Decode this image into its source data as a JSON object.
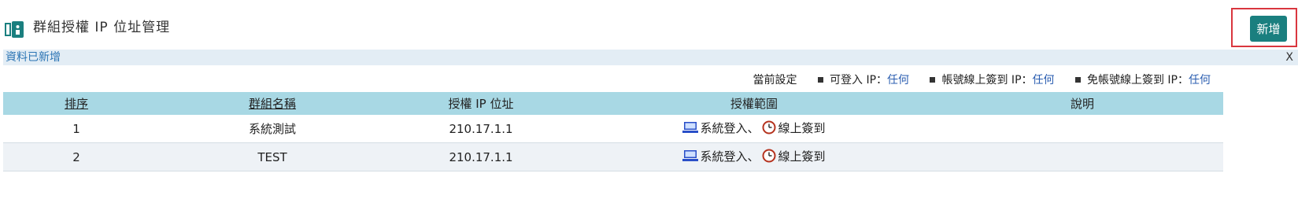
{
  "header": {
    "title": "群組授權 IP 位址管理",
    "add_label": "新增"
  },
  "alert": {
    "message": "資料已新增",
    "close_label": "X"
  },
  "settings": {
    "label": "當前設定",
    "items": [
      {
        "label": "可登入 IP：",
        "value": "任何"
      },
      {
        "label": "帳號線上簽到 IP：",
        "value": "任何"
      },
      {
        "label": "免帳號線上簽到 IP：",
        "value": "任何"
      }
    ]
  },
  "table": {
    "headers": [
      "排序",
      "群組名稱",
      "授權 IP 位址",
      "授權範圍",
      "說明"
    ],
    "rows": [
      {
        "order": "1",
        "name": "系統測試",
        "ip": "210.17.1.1",
        "scope_login": "系統登入、",
        "scope_checkin": "線上簽到",
        "desc": ""
      },
      {
        "order": "2",
        "name": "TEST",
        "ip": "210.17.1.1",
        "scope_login": "系統登入、",
        "scope_checkin": "線上簽到",
        "desc": ""
      }
    ]
  },
  "colors": {
    "accent": "#1a7f7f",
    "header_bg": "#a8d8e4",
    "alert_bg": "#e3edf5",
    "link": "#2a5db0",
    "highlight_border": "#d9363e"
  },
  "icons": {
    "title": "group-ip-icon",
    "login": "computer-icon",
    "checkin": "clock-icon"
  }
}
